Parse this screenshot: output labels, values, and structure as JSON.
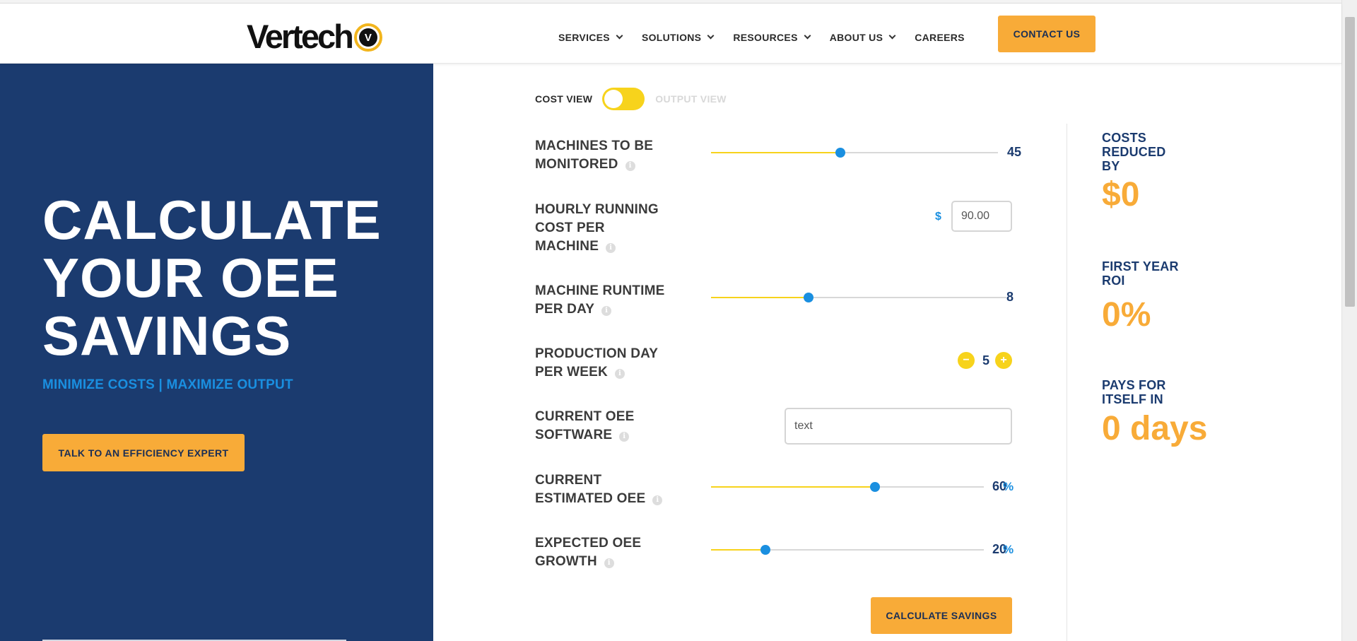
{
  "header": {
    "logo_text": "Vertech",
    "logo_badge": "V",
    "nav": [
      {
        "label": "SERVICES",
        "dropdown": true
      },
      {
        "label": "SOLUTIONS",
        "dropdown": true
      },
      {
        "label": "RESOURCES",
        "dropdown": true
      },
      {
        "label": "ABOUT US",
        "dropdown": true
      },
      {
        "label": "CAREERS",
        "dropdown": false
      }
    ],
    "contact_label": "CONTACT US"
  },
  "hero": {
    "title": "CALCULATE YOUR OEE SAVINGS",
    "subtitle": "MINIMIZE COSTS | MAXIMIZE OUTPUT",
    "cta_label": "TALK TO AN EFFICIENCY EXPERT"
  },
  "calculator": {
    "toggle": {
      "left_label": "COST VIEW",
      "right_label": "OUTPUT VIEW",
      "active": "COST VIEW"
    },
    "machines": {
      "label": "MACHINES TO BE MONITORED",
      "value": "45",
      "fraction": 0.45
    },
    "hourly_cost": {
      "label": "HOURLY RUNNING COST PER MACHINE",
      "currency": "$",
      "value": "90.00"
    },
    "runtime": {
      "label": "MACHINE RUNTIME PER DAY",
      "value": "8",
      "fraction": 0.33
    },
    "production_days": {
      "label": "PRODUCTION DAY PER WEEK",
      "value": "5",
      "minus": "−",
      "plus": "+"
    },
    "software": {
      "label": "CURRENT OEE SOFTWARE",
      "value": "text"
    },
    "current_oee": {
      "label": "CURRENT ESTIMATED OEE",
      "value": "60",
      "unit": "%",
      "fraction": 0.6
    },
    "expected_growth": {
      "label": "EXPECTED OEE GROWTH",
      "value": "20",
      "unit": "%",
      "fraction": 0.2
    },
    "calculate_label": "CALCULATE SAVINGS",
    "info_icon": "i"
  },
  "results": {
    "costs": {
      "label": "COSTS REDUCED BY",
      "value": "$0"
    },
    "roi": {
      "label": "FIRST YEAR ROI",
      "value": "0%"
    },
    "payback": {
      "label": "PAYS FOR ITSELF IN",
      "value": "0 days"
    }
  },
  "colors": {
    "navy": "#1b3b6f",
    "orange": "#f8ab38",
    "yellow": "#f7d31c",
    "blue": "#1a8fe0"
  }
}
